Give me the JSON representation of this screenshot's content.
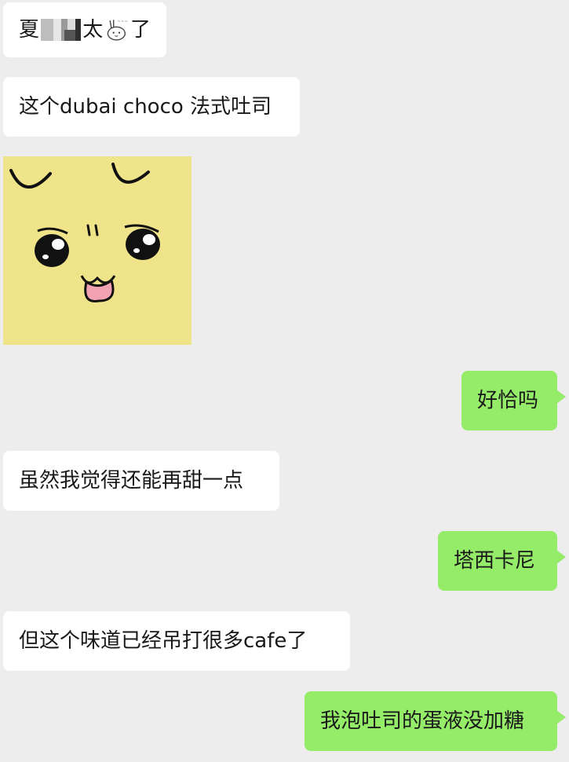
{
  "chat": {
    "messages": [
      {
        "id": "m1",
        "side": "in",
        "type": "text",
        "text_before": "夏",
        "text_after": "太",
        "text_end": "了",
        "redacted": true,
        "inline_sticker": "peace-bunny-sticker"
      },
      {
        "id": "m2",
        "side": "in",
        "type": "text",
        "text": "这个dubai choco 法式吐司"
      },
      {
        "id": "m3",
        "side": "in",
        "type": "sticker",
        "sticker": "yellow-happy-face-sticker"
      },
      {
        "id": "m4",
        "side": "out",
        "type": "text",
        "text": "好恰吗"
      },
      {
        "id": "m5",
        "side": "in",
        "type": "text",
        "text": "虽然我觉得还能再甜一点"
      },
      {
        "id": "m6",
        "side": "out",
        "type": "text",
        "text": "塔西卡尼"
      },
      {
        "id": "m7",
        "side": "in",
        "type": "text",
        "text": "但这个味道已经吊打很多cafe了"
      },
      {
        "id": "m8",
        "side": "out",
        "type": "text",
        "text": "我泡吐司的蛋液没加糖"
      }
    ]
  },
  "colors": {
    "background": "#ededed",
    "incoming_bubble": "#ffffff",
    "outgoing_bubble": "#95ec69",
    "text": "#191919",
    "sticker_bg": "#efe48a"
  }
}
